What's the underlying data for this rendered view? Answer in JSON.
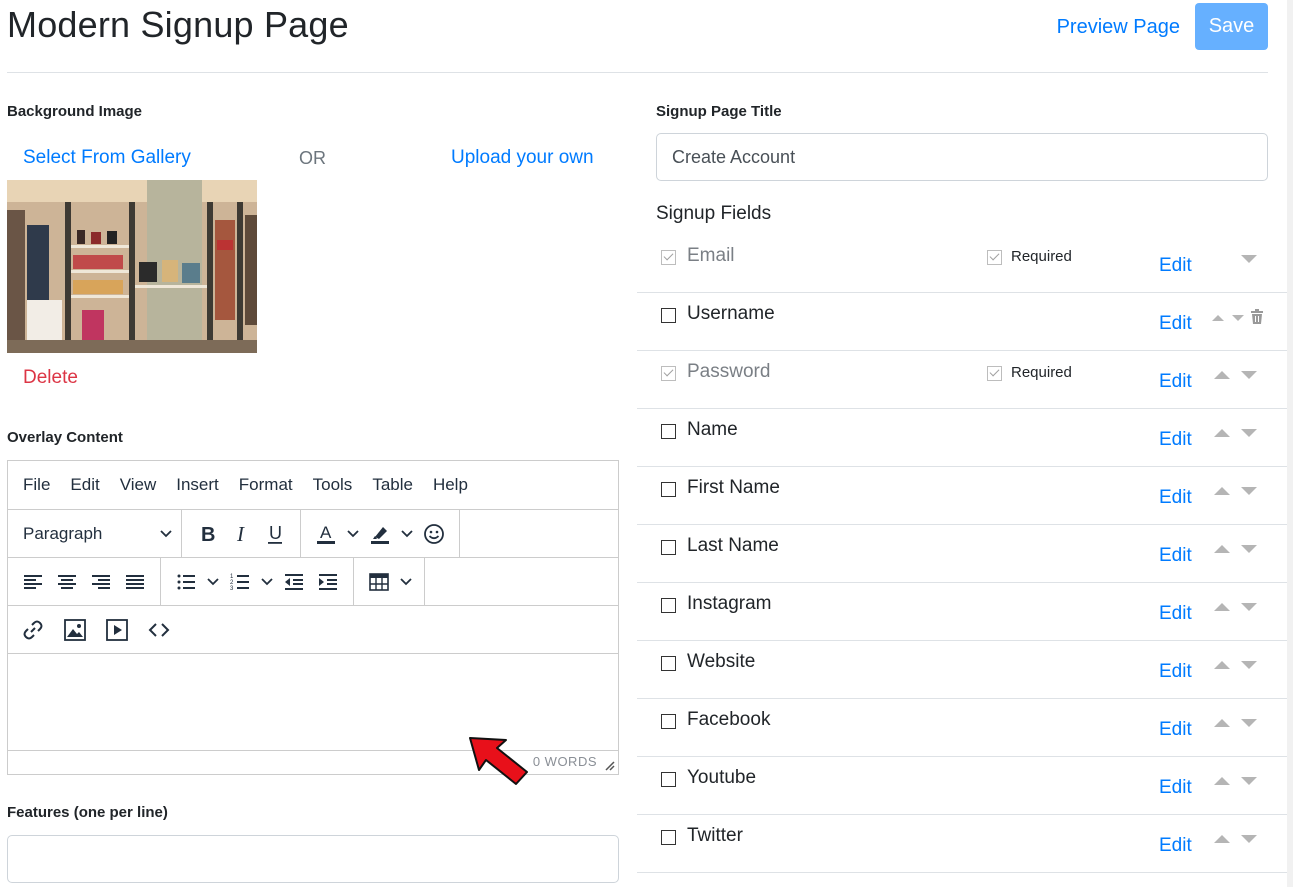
{
  "header": {
    "title": "Modern Signup Page",
    "preview_label": "Preview Page",
    "save_label": "Save"
  },
  "background": {
    "label": "Background Image",
    "gallery_link": "Select From Gallery",
    "or_text": "OR",
    "upload_link": "Upload your own",
    "delete_link": "Delete"
  },
  "overlay": {
    "label": "Overlay Content",
    "menu": [
      "File",
      "Edit",
      "View",
      "Insert",
      "Format",
      "Tools",
      "Table",
      "Help"
    ],
    "block_format": "Paragraph",
    "word_count": "0 WORDS"
  },
  "features": {
    "label": "Features (one per line)",
    "value": ""
  },
  "signup": {
    "title_label": "Signup Page Title",
    "title_value": "Create Account",
    "fields_label": "Signup Fields",
    "required_label": "Required",
    "edit_label": "Edit",
    "fields": [
      {
        "label": "Email",
        "checked": true,
        "required": true
      },
      {
        "label": "Username",
        "checked": false,
        "required": false
      },
      {
        "label": "Password",
        "checked": true,
        "required": true
      },
      {
        "label": "Name",
        "checked": false,
        "required": false
      },
      {
        "label": "First Name",
        "checked": false,
        "required": false
      },
      {
        "label": "Last Name",
        "checked": false,
        "required": false
      },
      {
        "label": "Instagram",
        "checked": false,
        "required": false
      },
      {
        "label": "Website",
        "checked": false,
        "required": false
      },
      {
        "label": "Facebook",
        "checked": false,
        "required": false
      },
      {
        "label": "Youtube",
        "checked": false,
        "required": false
      },
      {
        "label": "Twitter",
        "checked": false,
        "required": false
      }
    ]
  },
  "colors": {
    "link": "#007bff",
    "danger": "#dc3545",
    "save_button": "#66b0ff",
    "pointer_arrow": "#e8101a"
  }
}
